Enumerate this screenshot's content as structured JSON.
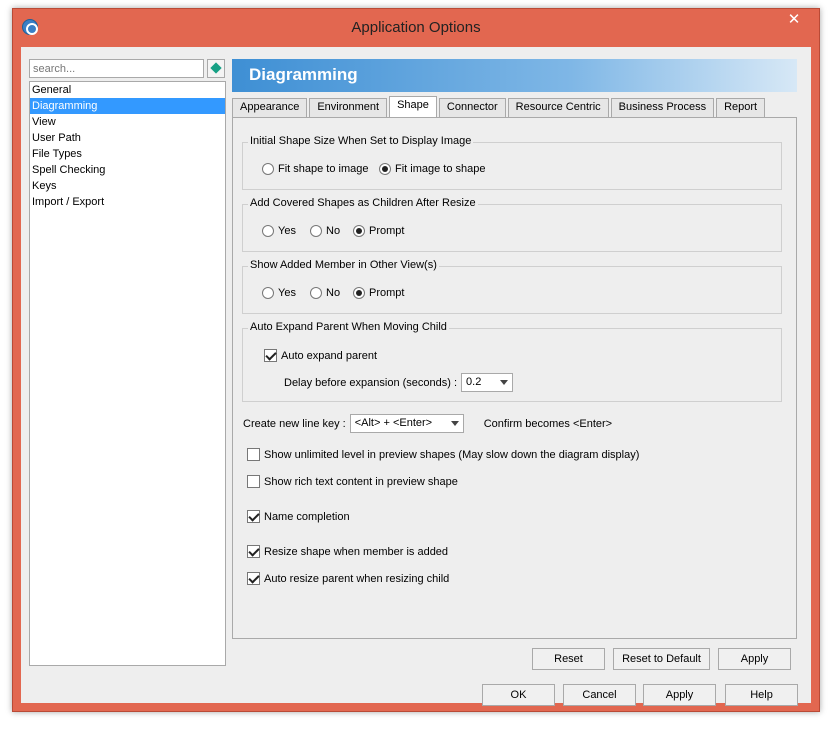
{
  "window": {
    "title": "Application Options"
  },
  "search": {
    "placeholder": "search..."
  },
  "categories": [
    "General",
    "Diagramming",
    "View",
    "User Path",
    "File Types",
    "Spell Checking",
    "Keys",
    "Import / Export"
  ],
  "header": {
    "title": "Diagramming"
  },
  "tabs": [
    "Appearance",
    "Environment",
    "Shape",
    "Connector",
    "Resource Centric",
    "Business Process",
    "Report"
  ],
  "shape": {
    "initial_size": {
      "title": "Initial Shape Size When Set to Display Image",
      "options": [
        "Fit shape to image",
        "Fit image to shape"
      ],
      "selected": "Fit image to shape"
    },
    "covered_shapes": {
      "title": "Add Covered Shapes as Children After Resize",
      "options": [
        "Yes",
        "No",
        "Prompt"
      ],
      "selected": "Prompt"
    },
    "added_member": {
      "title": "Show Added Member in Other View(s)",
      "options": [
        "Yes",
        "No",
        "Prompt"
      ],
      "selected": "Prompt"
    },
    "auto_expand": {
      "title": "Auto Expand Parent When Moving Child",
      "checkbox_label": "Auto expand parent",
      "checked": true,
      "delay_label": "Delay before expansion (seconds) :",
      "delay_value": "0.2"
    },
    "line_key": {
      "label": "Create new line key :",
      "value": "<Alt> + <Enter>",
      "confirm_text": "Confirm becomes <Enter>"
    },
    "options": [
      {
        "label": "Show unlimited level in preview shapes (May slow down the diagram display)",
        "checked": false
      },
      {
        "label": "Show rich text content in preview shape",
        "checked": false
      },
      {
        "label": "Name completion",
        "checked": true
      },
      {
        "label": "Resize shape when member is added",
        "checked": true
      },
      {
        "label": "Auto resize parent when resizing child",
        "checked": true
      }
    ]
  },
  "panel_buttons": {
    "reset": "Reset",
    "reset_default": "Reset to Default",
    "apply": "Apply"
  },
  "dialog_buttons": {
    "ok": "OK",
    "cancel": "Cancel",
    "apply": "Apply",
    "help": "Help"
  },
  "colors": {
    "window_frame": "#e26750",
    "selection": "#3399ff",
    "banner": "#3e8fd4"
  }
}
